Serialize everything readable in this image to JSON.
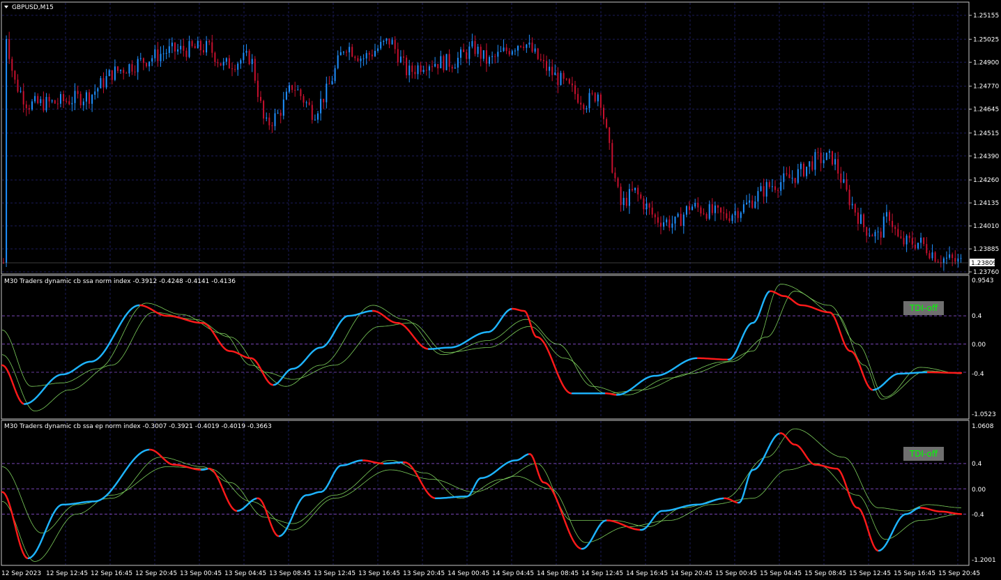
{
  "main": {
    "symbol_label": "GBPUSD,M15",
    "current_price": "1.23809",
    "price_axis": [
      "1.25155",
      "1.25025",
      "1.24900",
      "1.24770",
      "1.24645",
      "1.24515",
      "1.24390",
      "1.24260",
      "1.24135",
      "1.24010",
      "1.23885",
      "1.23760"
    ],
    "price_range": [
      1.2376,
      1.25155
    ]
  },
  "indicator1": {
    "title": "M30  Traders dynamic cb ssa norm index -0.3912 -0.4248 -0.4141 -0.4136",
    "button_label": "TDI-off",
    "axis": {
      "top": "0.9543",
      "l1": "0.4",
      "l2": "0.00",
      "l3": "-0.4",
      "bottom": "-1.0523"
    },
    "range": [
      -1.0523,
      0.9543
    ]
  },
  "indicator2": {
    "title": "M30  Traders dynamic cb ssa ep norm index -0.3007 -0.3921 -0.4019 -0.4019 -0.3663",
    "button_label": "TDI-off",
    "axis": {
      "top": "1.0608",
      "l1": "0.4",
      "l2": "0.00",
      "l3": "-0.4",
      "bottom": "-1.2001"
    },
    "range": [
      -1.2001,
      1.0608
    ]
  },
  "time_axis": [
    "12 Sep 2023",
    "12 Sep 12:45",
    "12 Sep 16:45",
    "12 Sep 20:45",
    "13 Sep 00:45",
    "13 Sep 04:45",
    "13 Sep 08:45",
    "13 Sep 12:45",
    "13 Sep 16:45",
    "13 Sep 20:45",
    "14 Sep 00:45",
    "14 Sep 04:45",
    "14 Sep 08:45",
    "14 Sep 12:45",
    "14 Sep 16:45",
    "14 Sep 20:45",
    "15 Sep 00:45",
    "15 Sep 04:45",
    "15 Sep 08:45",
    "15 Sep 12:45",
    "15 Sep 16:45",
    "15 Sep 20:45"
  ],
  "colors": {
    "background": "#000000",
    "grid": "#1c1c5a",
    "bull_candle": "#1e90ff",
    "bear_candle": "#c8102e",
    "level_line": "#8a4fd0",
    "tdi_up": "#1eb4ff",
    "tdi_down": "#ff1a1a",
    "signal": "#7dcf5c",
    "button_text": "#00ff00"
  }
}
